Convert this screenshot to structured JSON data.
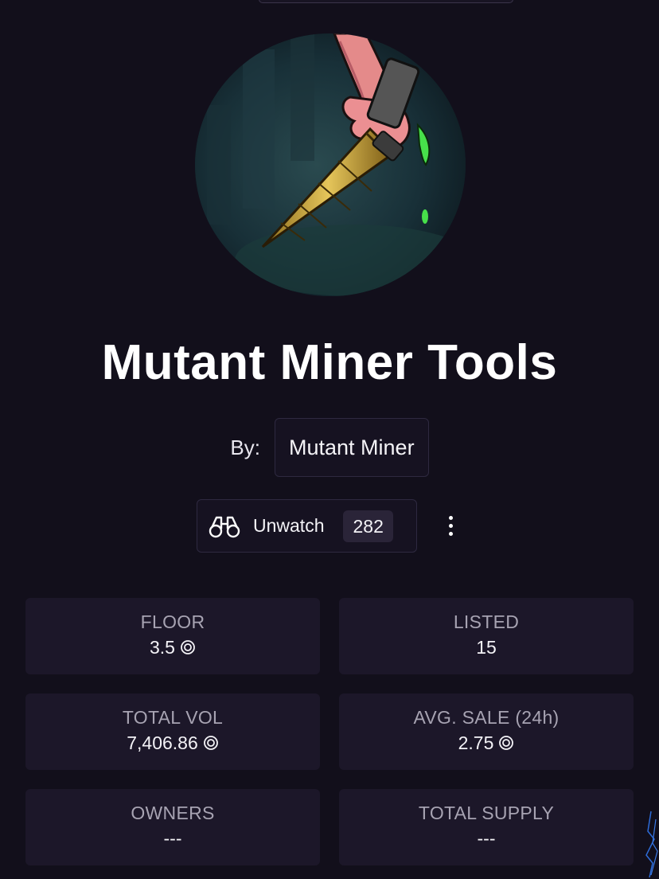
{
  "collection": {
    "title": "Mutant Miner Tools",
    "by_label": "By:",
    "creator": "Mutant Miner"
  },
  "actions": {
    "watch_label": "Unwatch",
    "watch_count": "282",
    "watch_icon": "binoculars-icon",
    "more_icon": "more-vertical-icon"
  },
  "stats": [
    {
      "label": "FLOOR",
      "value": "3.5",
      "unit_icon": "sol-icon"
    },
    {
      "label": "LISTED",
      "value": "15"
    },
    {
      "label": "TOTAL VOL",
      "value": "7,406.86",
      "unit_icon": "sol-icon"
    },
    {
      "label": "AVG. SALE (24h)",
      "value": "2.75",
      "unit_icon": "sol-icon"
    },
    {
      "label": "OWNERS",
      "value": "---"
    },
    {
      "label": "TOTAL SUPPLY",
      "value": "---"
    }
  ],
  "colors": {
    "background": "#120f1b",
    "card": "#1c1729",
    "border": "#2e2940",
    "muted_text": "#a7a3b2",
    "slime": "#47e04a",
    "drill_gold": "#c8a437"
  }
}
